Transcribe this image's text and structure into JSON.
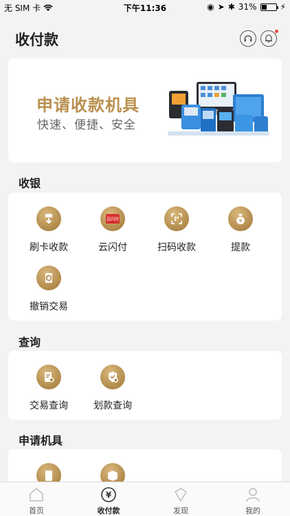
{
  "status_bar": {
    "carrier": "无 SIM 卡",
    "time": "下午11:36",
    "battery": "31%"
  },
  "header": {
    "title": "收付款"
  },
  "banner": {
    "title": "申请收款机具",
    "subtitle": "快速、便捷、安全"
  },
  "sections": {
    "cashier": {
      "title": "收银",
      "items": [
        "刷卡收款",
        "云闪付",
        "扫码收款",
        "提款",
        "撤销交易"
      ]
    },
    "query": {
      "title": "查询",
      "items": [
        "交易查询",
        "划款查询"
      ]
    },
    "apply": {
      "title": "申请机具"
    }
  },
  "tabbar": {
    "tabs": [
      "首页",
      "收付款",
      "发现",
      "我的"
    ],
    "active": 1
  },
  "colors": {
    "accent": "#b9904e",
    "badge": "#e74b3c"
  }
}
